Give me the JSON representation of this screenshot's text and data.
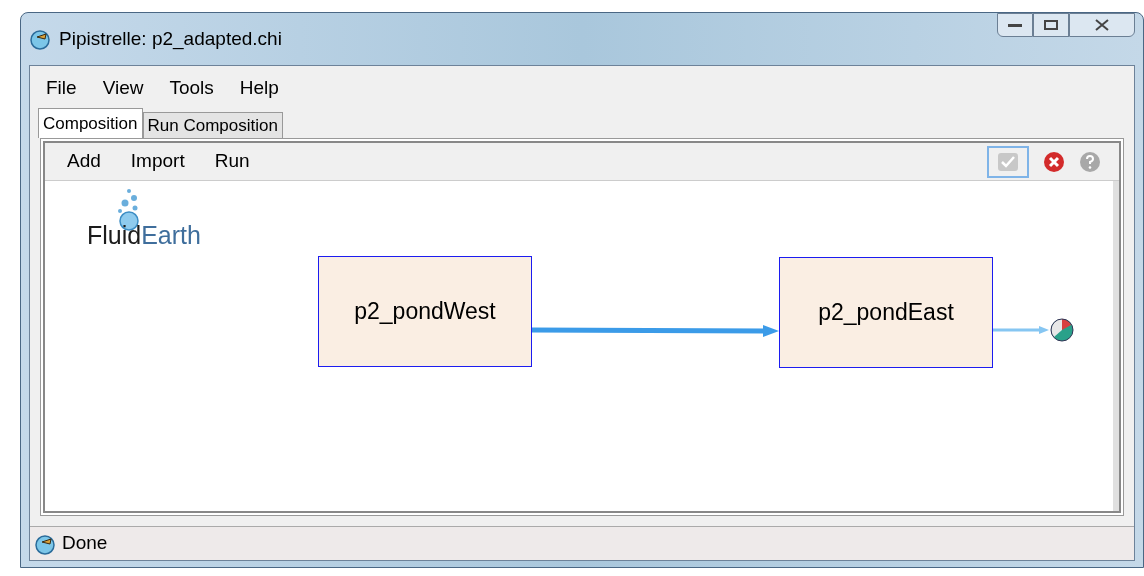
{
  "window": {
    "title": "Pipistrelle: p2_adapted.chi"
  },
  "menu": [
    "File",
    "View",
    "Tools",
    "Help"
  ],
  "tabs": [
    {
      "label": "Composition",
      "selected": true
    },
    {
      "label": "Run Composition",
      "selected": false
    }
  ],
  "toolbar": {
    "items": [
      "Add",
      "Import",
      "Run"
    ]
  },
  "canvas": {
    "logo": {
      "first": "Fluid",
      "second": "Earth"
    },
    "nodes": [
      {
        "label": "p2_pondWest"
      },
      {
        "label": "p2_pondEast"
      }
    ]
  },
  "status_bar": {
    "text": "Done"
  }
}
